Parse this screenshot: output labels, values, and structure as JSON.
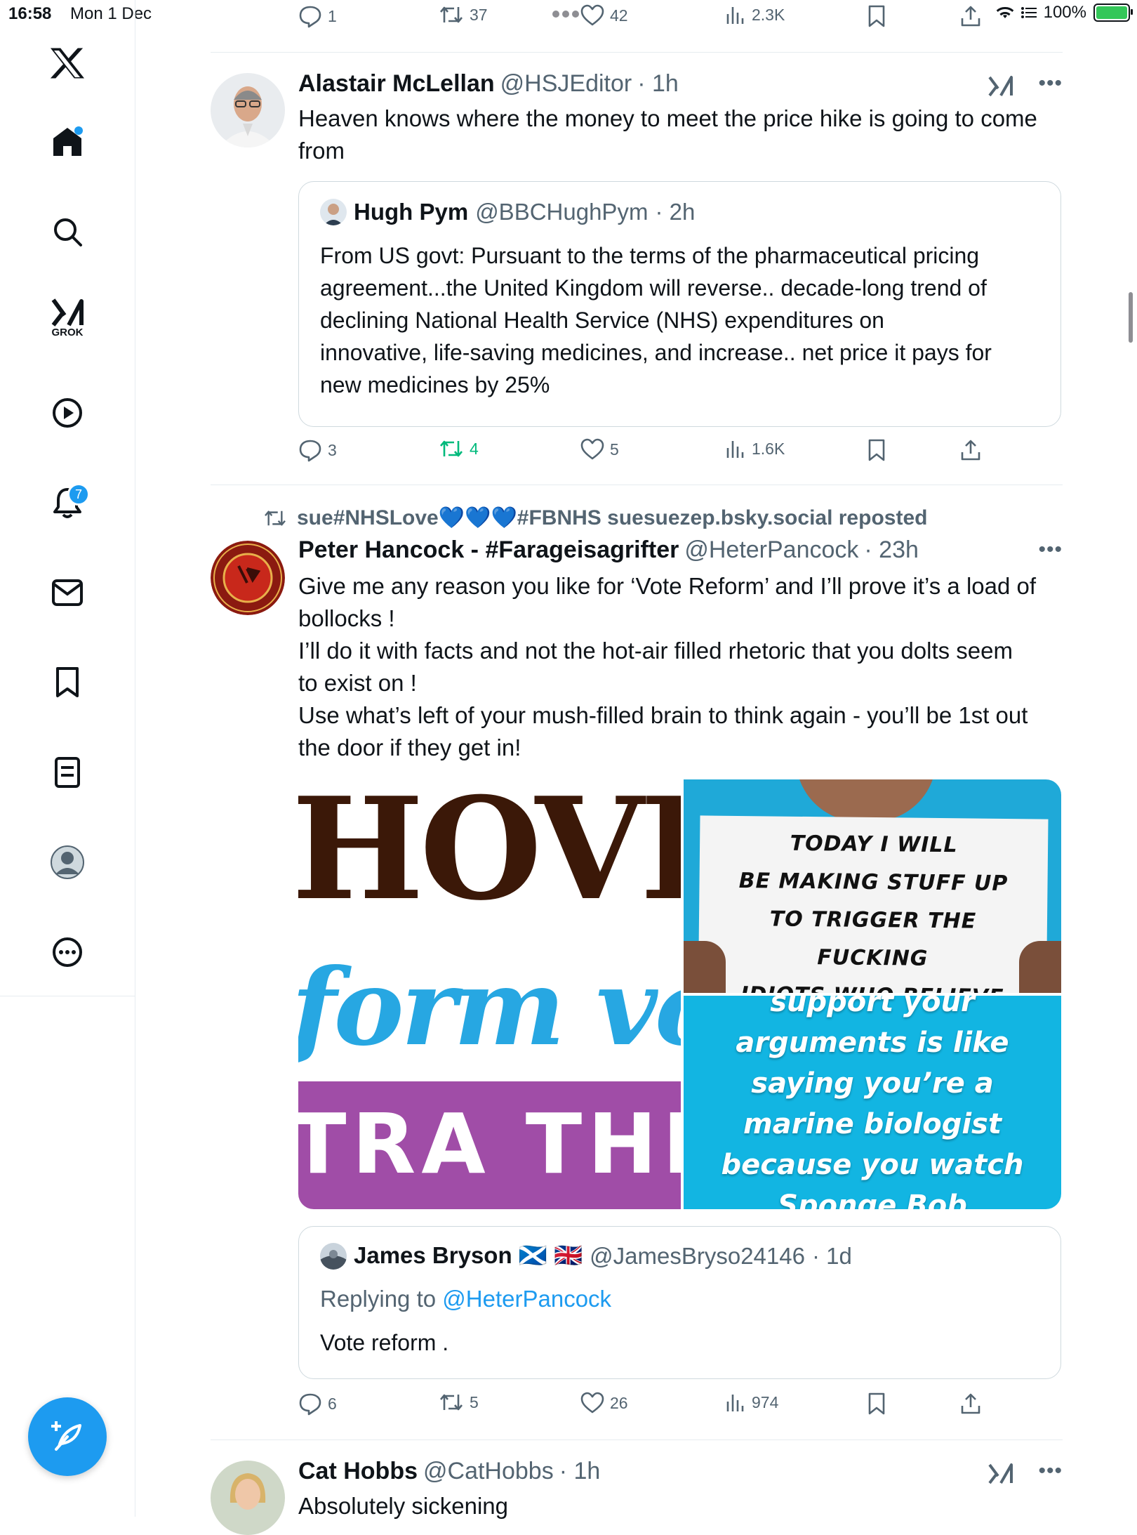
{
  "status_bar": {
    "time": "16:58",
    "date": "Mon 1 Dec",
    "battery": "100%",
    "battery_level": 1.0
  },
  "sidebar": {
    "grok_label": "GROK",
    "notifications_count": "7",
    "items": [
      "x-logo",
      "home",
      "search",
      "grok",
      "videos",
      "notifications",
      "messages",
      "bookmarks",
      "lists",
      "profile",
      "more"
    ]
  },
  "top_actions": {
    "replies": "1",
    "reposts": "37",
    "likes": "42",
    "views": "2.3K"
  },
  "tweets": [
    {
      "name": "Alastair McLellan",
      "handle": "@HSJEditor",
      "time": "· 1h",
      "text": "Heaven knows where the money to meet the price hike is going to come\nfrom",
      "quote": {
        "name": "Hugh Pym",
        "handle": "@BBCHughPym",
        "time": "· 2h",
        "text": "From US govt: Pursuant to the terms of the pharmaceutical pricing\nagreement...the United Kingdom will reverse.. decade-long trend of\ndeclining National Health Service (NHS) expenditures on\ninnovative, life-saving medicines, and increase.. net price it pays for\nnew medicines by 25%"
      },
      "actions": {
        "replies": "3",
        "reposts": "4",
        "likes": "5",
        "views": "1.6K"
      }
    },
    {
      "repost_label": "sue#NHSLove💙💙💙#FBNHS suesuezep.bsky.social reposted",
      "name": "Peter Hancock - #Farageisagrifter",
      "handle": "@HeterPancock",
      "time": "· 23h",
      "text": "Give me any reason you like for ‘Vote Reform’ and I’ll prove it’s a load of\nbollocks !\nI’ll do it with facts and not the hot-air filled rhetoric that you dolts seem\nto exist on !\nUse what’s left of your mush-filled brain to think again - you’ll be 1st out\nthe door if they get in!",
      "media": {
        "image1_line1": "HOVIS",
        "image1_line2": "form vo",
        "image1_line3": "TRA THI",
        "image2_text": "TODAY I WILL\nBE MAKING STUFF UP\nTO TRIGGER THE\nFUCKING\nIDIOTS WHO BELIEVE",
        "image3_text": "support your\narguments is like\nsaying you’re a\nmarine biologist\nbecause you watch\nSponge Bob"
      },
      "quote": {
        "name": "James Bryson 🏴󠁧󠁢󠁳󠁣󠁴󠁿 🇬🇧",
        "handle": "@JamesBryso24146",
        "time": "· 1d",
        "replying_to_label": "Replying to",
        "replying_to": "@HeterPancock",
        "text": "Vote reform ."
      },
      "actions": {
        "replies": "6",
        "reposts": "5",
        "likes": "26",
        "views": "974"
      }
    },
    {
      "name": "Cat Hobbs",
      "handle": "@CatHobbs",
      "time": "· 1h",
      "text": "Absolutely sickening"
    }
  ],
  "colors": {
    "accent": "#1d9bf0",
    "repost_green": "#00ba7c",
    "secondary_text": "#536471",
    "border": "#cfd9de"
  }
}
